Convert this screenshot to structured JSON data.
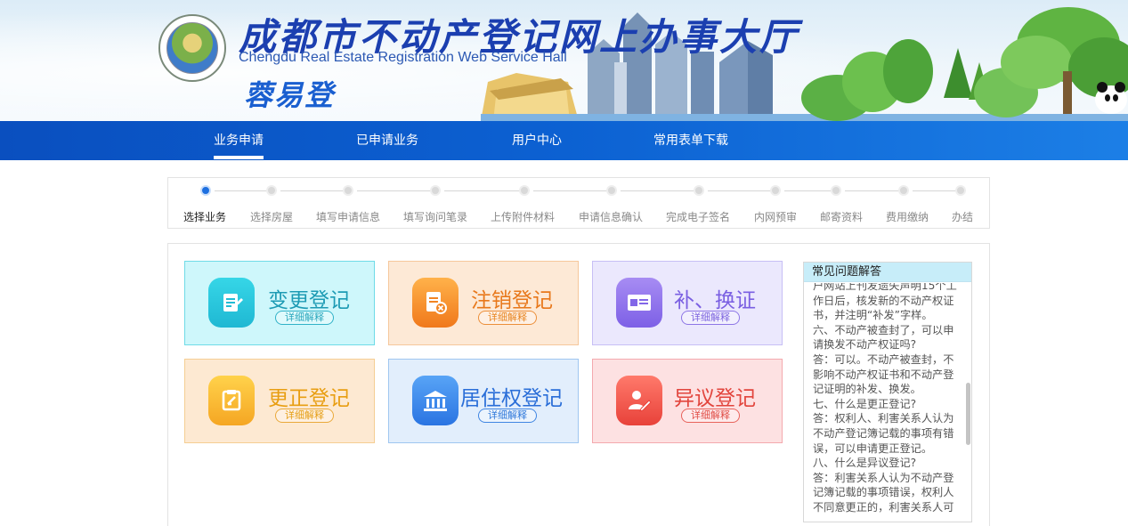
{
  "header": {
    "title_cn": "成都市不动产登记网上办事大厅",
    "title_en": "Chengdu Real Estate Registration Web Service Hall",
    "brand": "蓉易登"
  },
  "nav": {
    "items": [
      {
        "label": "业务申请",
        "active": true
      },
      {
        "label": "已申请业务",
        "active": false
      },
      {
        "label": "用户中心",
        "active": false
      },
      {
        "label": "常用表单下载",
        "active": false
      }
    ]
  },
  "steps": [
    {
      "label": "选择业务",
      "active": true
    },
    {
      "label": "选择房屋",
      "active": false
    },
    {
      "label": "填写申请信息",
      "active": false
    },
    {
      "label": "填写询问笔录",
      "active": false
    },
    {
      "label": "上传附件材料",
      "active": false
    },
    {
      "label": "申请信息确认",
      "active": false
    },
    {
      "label": "完成电子签名",
      "active": false
    },
    {
      "label": "内网预审",
      "active": false
    },
    {
      "label": "邮寄资料",
      "active": false
    },
    {
      "label": "费用缴纳",
      "active": false
    },
    {
      "label": "办结",
      "active": false
    }
  ],
  "cards": [
    {
      "title": "变更登记",
      "detail": "详细解释",
      "icon": "document-edit-icon",
      "color": "#1fb8d3"
    },
    {
      "title": "注销登记",
      "detail": "详细解释",
      "icon": "document-cancel-icon",
      "color": "#f0781b"
    },
    {
      "title": "补、换证",
      "detail": "详细解释",
      "icon": "id-card-icon",
      "color": "#7d60e6"
    },
    {
      "title": "更正登记",
      "detail": "详细解释",
      "icon": "correction-icon",
      "color": "#f5a623"
    },
    {
      "title": "居住权登记",
      "detail": "详细解释",
      "icon": "institution-icon",
      "color": "#2a74e2"
    },
    {
      "title": "异议登记",
      "detail": "详细解释",
      "icon": "objection-icon",
      "color": "#e8423a"
    }
  ],
  "faq": {
    "title": "常见问题解答",
    "text": "户网站上刊发遗失声明15个工作日后，核发新的不动产权证书，并注明“补发”字样。\n六、不动产被查封了，可以申请换发不动产权证吗?\n答：可以。不动产被查封，不影响不动产权证书和不动产登记证明的补发、换发。\n七、什么是更正登记?\n答：权利人、利害关系人认为不动产登记簿记载的事项有错误，可以申请更正登记。\n八、什么是异议登记?\n答：利害关系人认为不动产登记簿记载的事项错误，权利人不同意更正的，利害关系人可"
  }
}
